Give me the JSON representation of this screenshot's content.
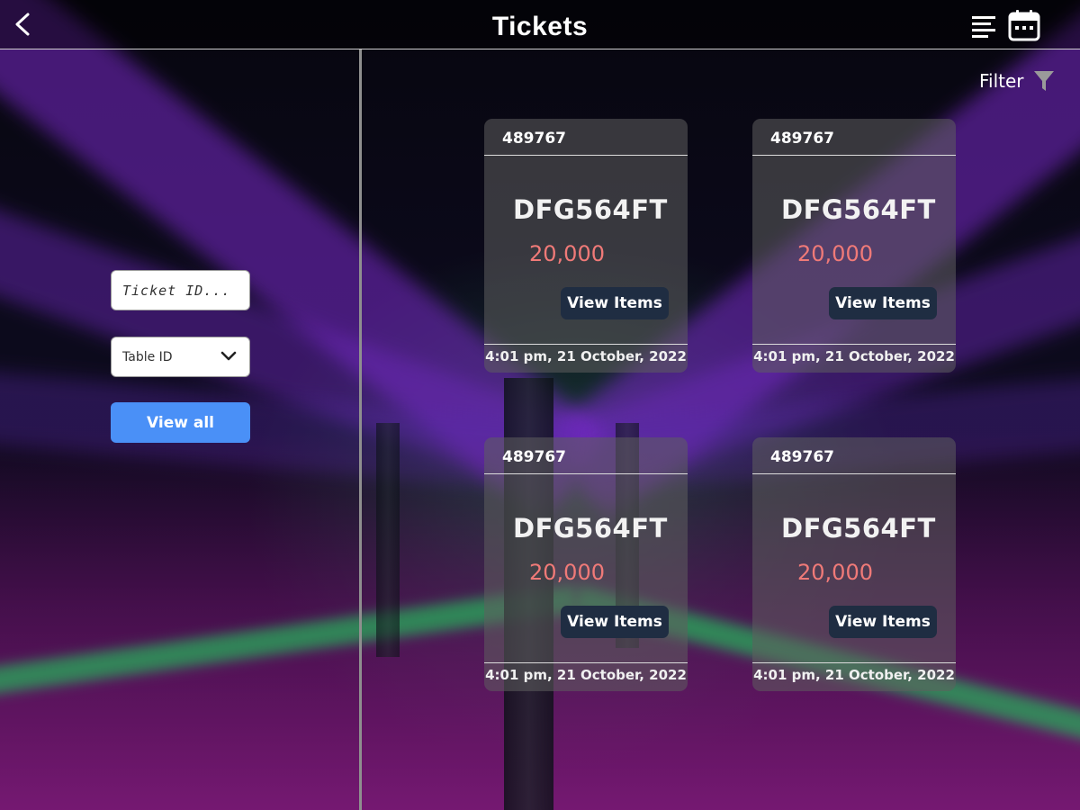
{
  "header": {
    "title": "Tickets"
  },
  "search": {
    "placeholder": "Ticket ID..."
  },
  "table_select": {
    "value": "Table ID"
  },
  "view_all_label": "View all",
  "filter_label": "Filter",
  "tickets": [
    {
      "id": "489767",
      "code": "DFG564FT",
      "amount": "20,000",
      "button_label": "View Items",
      "timestamp": "4:01 pm, 21 October, 2022"
    },
    {
      "id": "489767",
      "code": "DFG564FT",
      "amount": "20,000",
      "button_label": "View Items",
      "timestamp": "4:01 pm, 21 October, 2022"
    },
    {
      "id": "489767",
      "code": "DFG564FT",
      "amount": "20,000",
      "button_label": "View Items",
      "timestamp": "4:01 pm, 21 October, 2022"
    },
    {
      "id": "489767",
      "code": "DFG564FT",
      "amount": "20,000",
      "button_label": "View Items",
      "timestamp": "4:01 pm, 21 October, 2022"
    }
  ],
  "colors": {
    "accent_button": "#4a90f7",
    "amount_text": "#f07a78",
    "card_button": "#1f2d42"
  },
  "icons": [
    "back-arrow-icon",
    "sort-lines-icon",
    "calendar-icon",
    "chevron-down-icon",
    "funnel-icon"
  ]
}
